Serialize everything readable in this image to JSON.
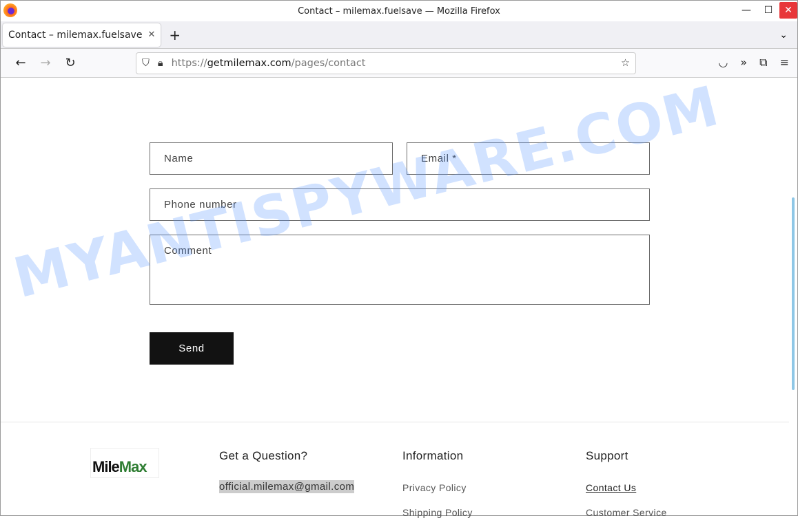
{
  "window": {
    "title": "Contact – milemax.fuelsave — Mozilla Firefox"
  },
  "tab": {
    "label": "Contact – milemax.fuelsave"
  },
  "url": {
    "scheme": "https://",
    "host": "getmilemax.com",
    "path": "/pages/contact"
  },
  "form": {
    "name_placeholder": "Name",
    "email_placeholder": "Email *",
    "phone_placeholder": "Phone number",
    "comment_placeholder": "Comment",
    "send_label": "Send"
  },
  "footer": {
    "logo": {
      "part1": "Mile",
      "part2": "Max"
    },
    "question": {
      "title": "Get a Question?",
      "email": "official.milemax@gmail.com"
    },
    "information": {
      "title": "Information",
      "links": [
        "Privacy Policy",
        "Shipping Policy"
      ]
    },
    "support": {
      "title": "Support",
      "links": [
        "Contact Us",
        "Customer Service"
      ]
    }
  },
  "watermark": "MYANTISPYWARE.COM"
}
